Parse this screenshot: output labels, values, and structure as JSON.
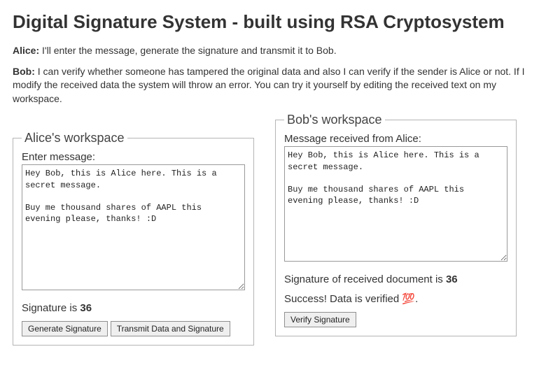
{
  "page": {
    "title": "Digital Signature System - built using RSA Cryptosystem"
  },
  "intro": {
    "alice_name": "Alice:",
    "alice_text": "I'll enter the message, generate the signature and transmit it to Bob.",
    "bob_name": "Bob:",
    "bob_text": "I can verify whether someone has tampered the original data and also I can verify if the sender is Alice or not. If I modify the received data the system will throw an error. You can try it yourself by editing the received text on my workspace."
  },
  "alice": {
    "legend": "Alice's workspace",
    "msg_label": "Enter message:",
    "msg_value": "Hey Bob, this is Alice here. This is a secret message.\n\nBuy me thousand shares of AAPL this evening please, thanks! :D",
    "sig_prefix": "Signature is ",
    "sig_value": "36",
    "btn_generate": "Generate Signature",
    "btn_transmit": "Transmit Data and Signature"
  },
  "bob": {
    "legend": "Bob's workspace",
    "msg_label": "Message received from Alice:",
    "msg_value": "Hey Bob, this is Alice here. This is a secret message.\n\nBuy me thousand shares of AAPL this evening please, thanks! :D",
    "sig_prefix": "Signature of received document is ",
    "sig_value": "36",
    "status": "Success! Data is verified 💯.",
    "btn_verify": "Verify Signature"
  }
}
